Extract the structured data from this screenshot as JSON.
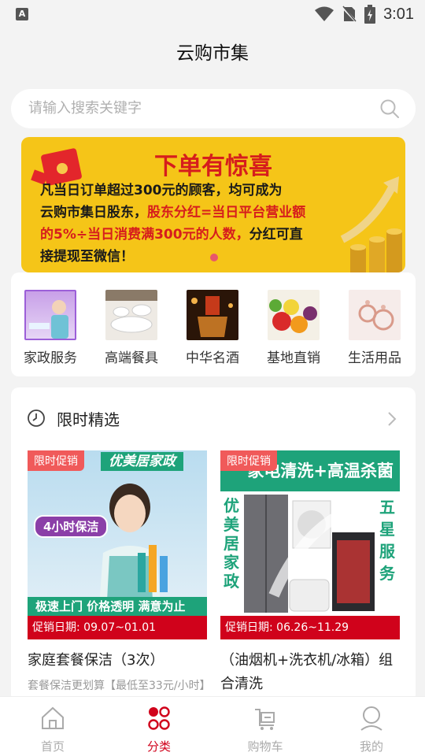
{
  "status_bar": {
    "time": "3:01",
    "app_badge": "A"
  },
  "header": {
    "title": "云购市集"
  },
  "search": {
    "placeholder": "请输入搜索关键字"
  },
  "banner": {
    "headline": "下单有惊喜",
    "line1": "凡当日订单超过300元的顾客，均可成为",
    "line2a": "云购市集日股东，",
    "line2b": "股东分红=当日平台营业额",
    "line3a": "的5%÷当日消费满300元的人数，",
    "line3b": "分红可直",
    "line4": "接提现至微信！"
  },
  "categories": [
    {
      "label": "家政服务",
      "icon": "housekeeping-thumb"
    },
    {
      "label": "高端餐具",
      "icon": "tableware-thumb"
    },
    {
      "label": "中华名酒",
      "icon": "liquor-thumb"
    },
    {
      "label": "基地直销",
      "icon": "fruit-thumb"
    },
    {
      "label": "生活用品",
      "icon": "earrings-thumb"
    }
  ],
  "flash_sale": {
    "title": "限时精选",
    "products": [
      {
        "tag": "限时促销",
        "banner_text": "优美居家政",
        "badge_text": "4小时保洁",
        "bottom_text": "极速上门 价格透明 满意为止",
        "date": "促销日期: 09.07~01.01",
        "name": "家庭套餐保洁（3次）",
        "desc": "套餐保洁更划算【最低至33元/小时】"
      },
      {
        "tag": "限时促销",
        "banner_text": "家电清洗+高温杀菌",
        "left_text": "优美居家政",
        "right_text": "五星服务",
        "date": "促销日期: 06.26~11.29",
        "name": "（油烟机+洗衣机/冰箱）组合清洗",
        "desc": ""
      }
    ]
  },
  "tabs": [
    {
      "label": "首页",
      "icon": "home-icon",
      "active": false
    },
    {
      "label": "分类",
      "icon": "category-icon",
      "active": true
    },
    {
      "label": "购物车",
      "icon": "cart-icon",
      "active": false
    },
    {
      "label": "我的",
      "icon": "profile-icon",
      "active": false
    }
  ],
  "colors": {
    "accent": "#d0021b",
    "banner_bg": "#f5c518",
    "tag_bg": "#f05a5a"
  }
}
